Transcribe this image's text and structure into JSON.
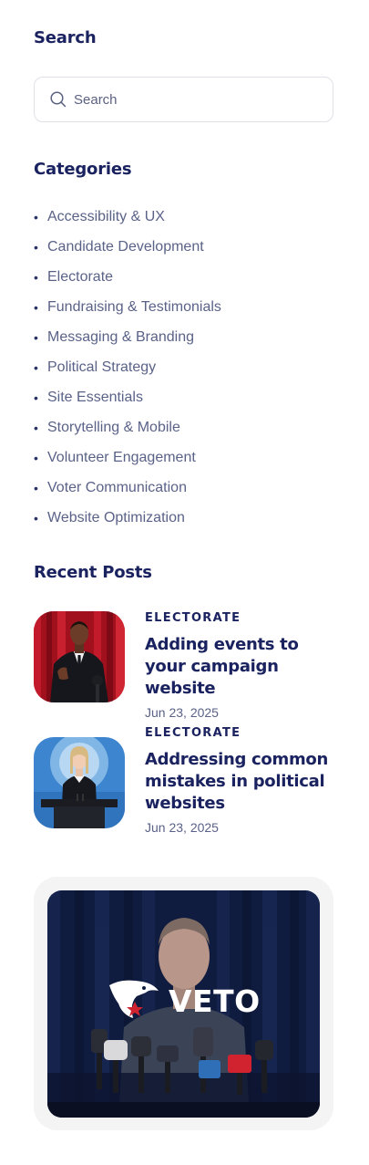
{
  "search": {
    "heading": "Search",
    "placeholder": "Search",
    "icon": "search-icon"
  },
  "categories": {
    "heading": "Categories",
    "items": [
      "Accessibility & UX",
      "Candidate Development",
      "Electorate",
      "Fundraising & Testimonials",
      "Messaging & Branding",
      "Political Strategy",
      "Site Essentials",
      "Storytelling & Mobile",
      "Volunteer Engagement",
      "Voter Communication",
      "Website Optimization"
    ]
  },
  "recent_posts": {
    "heading": "Recent Posts",
    "posts": [
      {
        "category": "ELECTORATE",
        "title": "Adding events to your campaign website",
        "date": "Jun 23, 2025",
        "image": "speaker-with-microphones-red-curtain"
      },
      {
        "category": "ELECTORATE",
        "title": "Addressing common mistakes in political websites",
        "date": "Jun 23, 2025",
        "image": "woman-at-podium-blue-background"
      }
    ]
  },
  "promo": {
    "brand": "VETO",
    "logo": "eagle-logo-icon",
    "image": "woman-at-press-conference-microphones",
    "mic_labels": [
      "TV",
      "TV",
      "PRESS"
    ]
  },
  "colors": {
    "heading": "#1a2260",
    "body_text": "#5a6288",
    "border": "#dfe1e7",
    "card_bg": "#f4f4f5",
    "accent_red": "#d1232f",
    "navy": "#101c3f"
  }
}
